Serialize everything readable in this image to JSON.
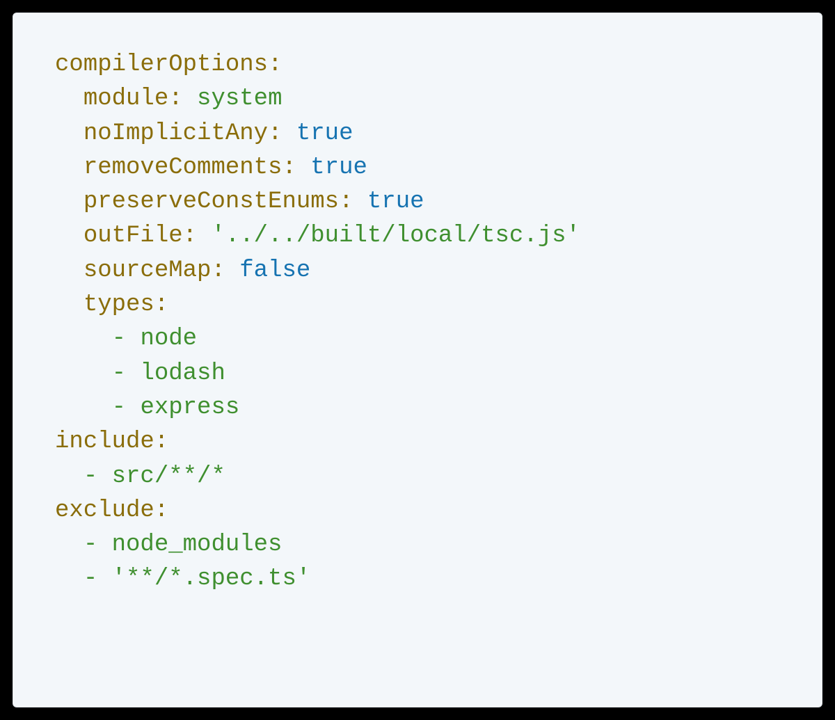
{
  "yaml": {
    "compilerOptions": {
      "key": "compilerOptions",
      "module": {
        "key": "module",
        "value": "system"
      },
      "noImplicitAny": {
        "key": "noImplicitAny",
        "value": "true"
      },
      "removeComments": {
        "key": "removeComments",
        "value": "true"
      },
      "preserveConstEnums": {
        "key": "preserveConstEnums",
        "value": "true"
      },
      "outFile": {
        "key": "outFile",
        "value": "'../../built/local/tsc.js'"
      },
      "sourceMap": {
        "key": "sourceMap",
        "value": "false"
      },
      "types": {
        "key": "types",
        "items": [
          "node",
          "lodash",
          "express"
        ]
      }
    },
    "include": {
      "key": "include",
      "items": [
        "src/**/*"
      ]
    },
    "exclude": {
      "key": "exclude",
      "items": [
        "node_modules",
        "'**/*.spec.ts'"
      ]
    }
  },
  "colors": {
    "key": "#8a6d0a",
    "string": "#3f8f2f",
    "boolean": "#1673b1",
    "background": "#f3f7fa"
  }
}
